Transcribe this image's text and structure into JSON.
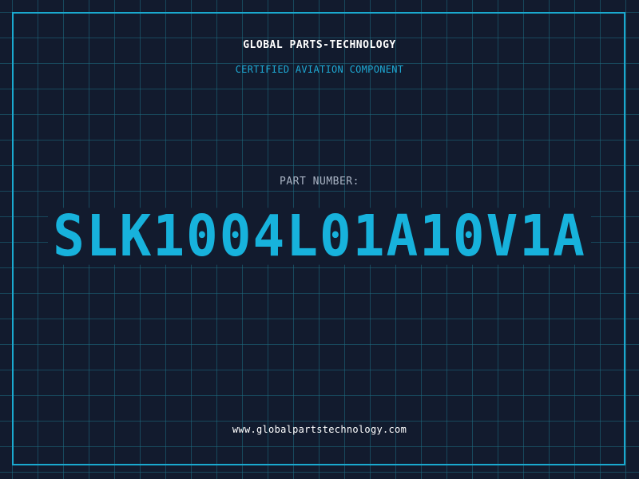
{
  "header": {
    "brand": "GLOBAL PARTS-TECHNOLOGY",
    "subtitle": "CERTIFIED AVIATION COMPONENT"
  },
  "part": {
    "label": "PART NUMBER:",
    "number": "SLK1004L01A10V1A"
  },
  "footer": {
    "url": "www.globalpartstechnology.com"
  },
  "colors": {
    "background": "#121b2e",
    "grid": "#1e6e82",
    "accent": "#17b2dc",
    "frame": "#1aa9cf",
    "label": "#aab4c4",
    "text": "#ffffff"
  }
}
